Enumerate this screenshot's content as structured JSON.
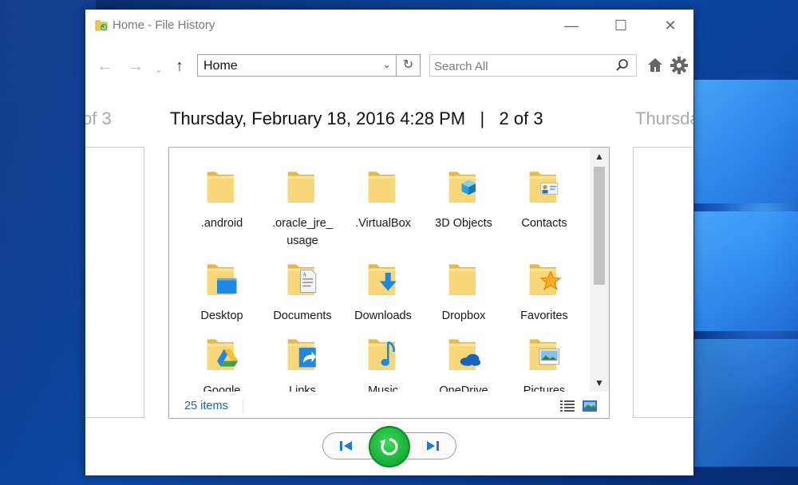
{
  "window": {
    "title": "Home - File History",
    "controls": {
      "minimize": "—",
      "maximize": "☐",
      "close": "✕"
    }
  },
  "nav": {
    "back": "←",
    "forward": "→",
    "history_dropdown": "⌄",
    "up": "↑",
    "address_value": "Home",
    "address_chevron": "⌄",
    "refresh": "↻",
    "search_placeholder": "Search All"
  },
  "date_bar": {
    "prev_ghost": "of 3",
    "main": "Thursday, February 18, 2016 4:28 PM   |   2 of 3",
    "next_ghost": "Thursda"
  },
  "files": [
    {
      "name": ".android",
      "icon": "folder-icon"
    },
    {
      "name": ".oracle_jre_\nusage",
      "icon": "folder-icon"
    },
    {
      "name": ".VirtualBox",
      "icon": "folder-icon"
    },
    {
      "name": "3D Objects",
      "icon": "3d-objects-folder-icon"
    },
    {
      "name": "Contacts",
      "icon": "contacts-folder-icon"
    },
    {
      "name": "Desktop",
      "icon": "desktop-folder-icon"
    },
    {
      "name": "Documents",
      "icon": "documents-folder-icon"
    },
    {
      "name": "Downloads",
      "icon": "downloads-folder-icon"
    },
    {
      "name": "Dropbox",
      "icon": "folder-icon"
    },
    {
      "name": "Favorites",
      "icon": "favorites-folder-icon"
    },
    {
      "name": "Google\nDrive",
      "icon": "google-drive-folder-icon"
    },
    {
      "name": "Links",
      "icon": "links-folder-icon"
    },
    {
      "name": "Music",
      "icon": "music-folder-icon"
    },
    {
      "name": "OneDrive",
      "icon": "onedrive-folder-icon"
    },
    {
      "name": "Pictures",
      "icon": "pictures-folder-icon"
    }
  ],
  "status": {
    "item_count": "25 items"
  },
  "colors": {
    "folder": "#f5d26b",
    "folder_dark": "#e4b84a",
    "accent_blue": "#1f78d1",
    "restore_green": "#19b53a"
  }
}
